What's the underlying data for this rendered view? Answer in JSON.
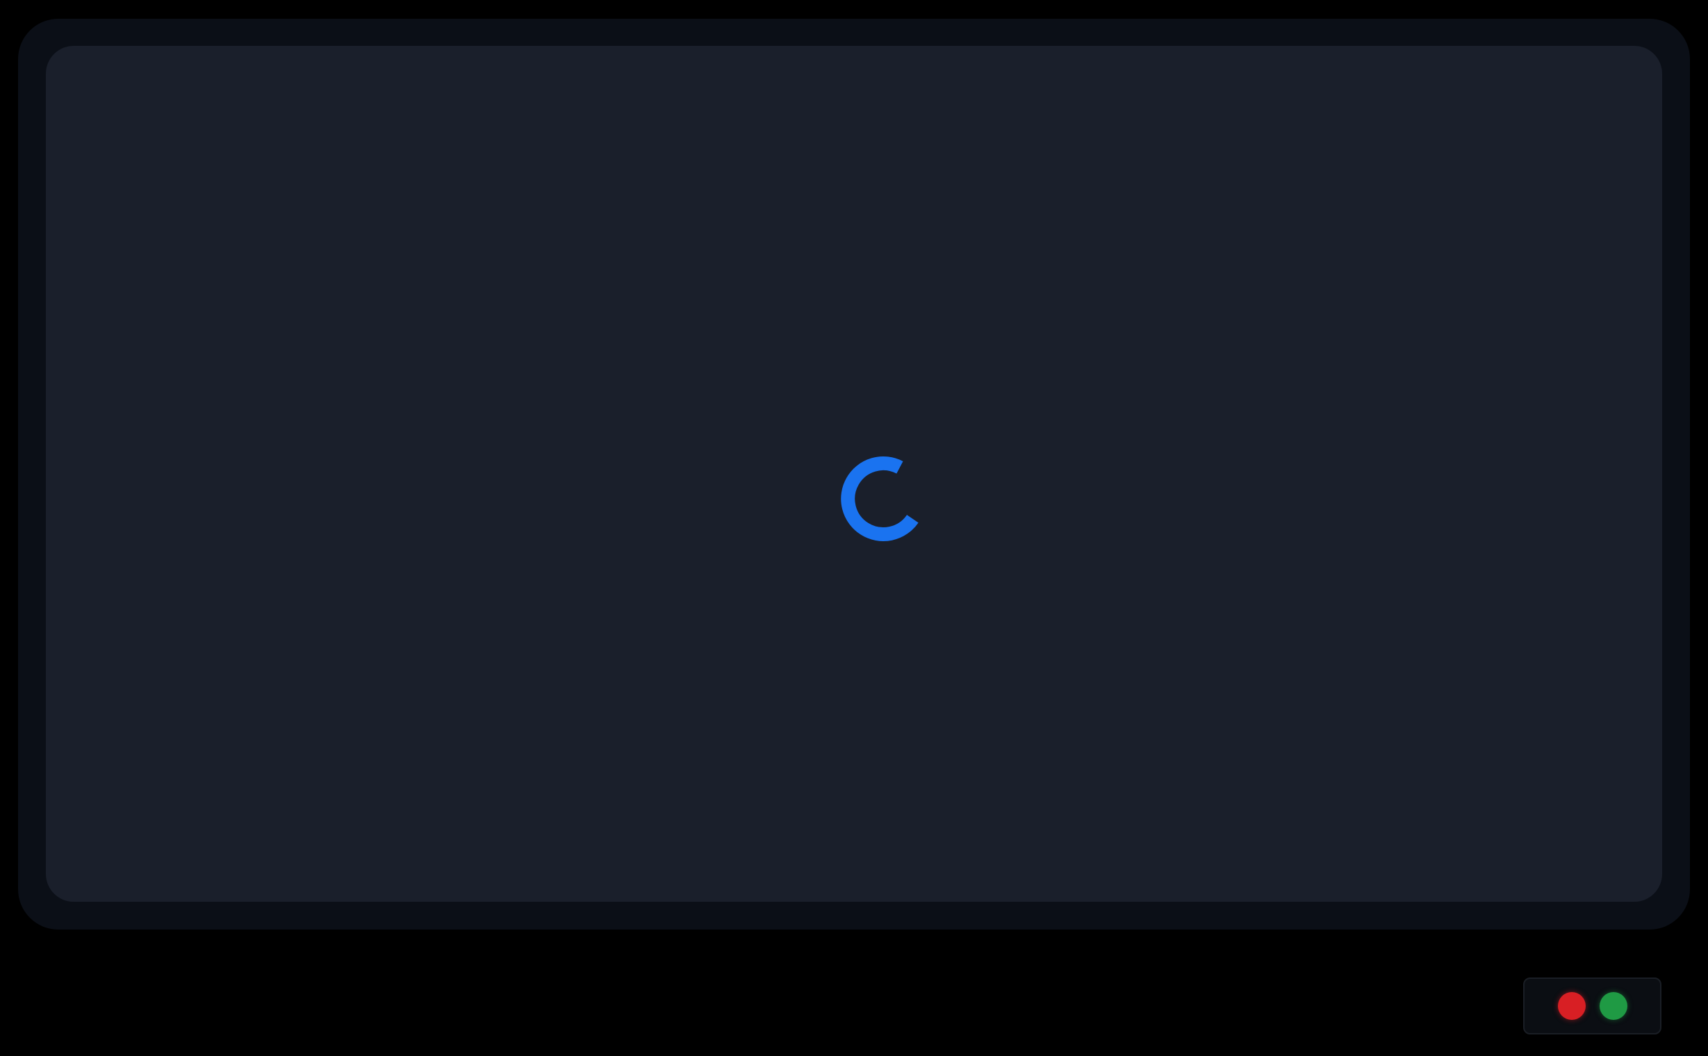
{
  "colors": {
    "page_background": "#000000",
    "frame": "#0b0f17",
    "screen": "#1a1f2b",
    "spinner_accent": "#1a73f0",
    "indicator_red": "#d81f24",
    "indicator_green": "#1f9a44",
    "tray_background": "#0b0e13"
  },
  "screen": {
    "state": "loading",
    "spinner_icon": "loading-spinner-icon"
  },
  "status_tray": {
    "indicators": [
      {
        "name": "red-indicator-icon",
        "color": "red",
        "lit": true
      },
      {
        "name": "green-indicator-icon",
        "color": "green",
        "lit": true
      }
    ]
  }
}
